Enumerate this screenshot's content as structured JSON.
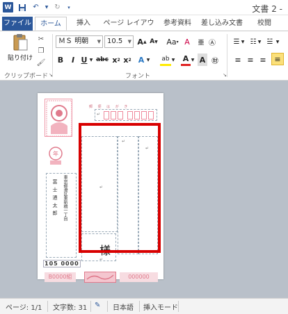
{
  "window": {
    "document_title": "文書 2 -"
  },
  "ribbon": {
    "tabs": [
      {
        "label": "ファイル"
      },
      {
        "label": "ホーム"
      },
      {
        "label": "挿入"
      },
      {
        "label": "ページ レイアウト"
      },
      {
        "label": "参考資料"
      },
      {
        "label": "差し込み文書"
      },
      {
        "label": "校閲"
      }
    ],
    "clipboard": {
      "paste_label": "貼り付け",
      "group_label": "クリップボード"
    },
    "font": {
      "font_name": "ＭＳ 明朝",
      "font_size": "10.5",
      "group_label": "フォント"
    }
  },
  "document": {
    "postcard_header": "郵 便 は が き",
    "sender_zip": "105 0000",
    "sender_name": "富 士 通 太 郎",
    "sender_address": "東京都港区東新橋一丁目",
    "honorific": "様",
    "lottery_left": "B0000組",
    "lottery_right": "000000"
  },
  "statusbar": {
    "page": "ページ: 1/1",
    "word_count": "文字数: 31",
    "language": "日本語",
    "mode": "挿入モード"
  }
}
